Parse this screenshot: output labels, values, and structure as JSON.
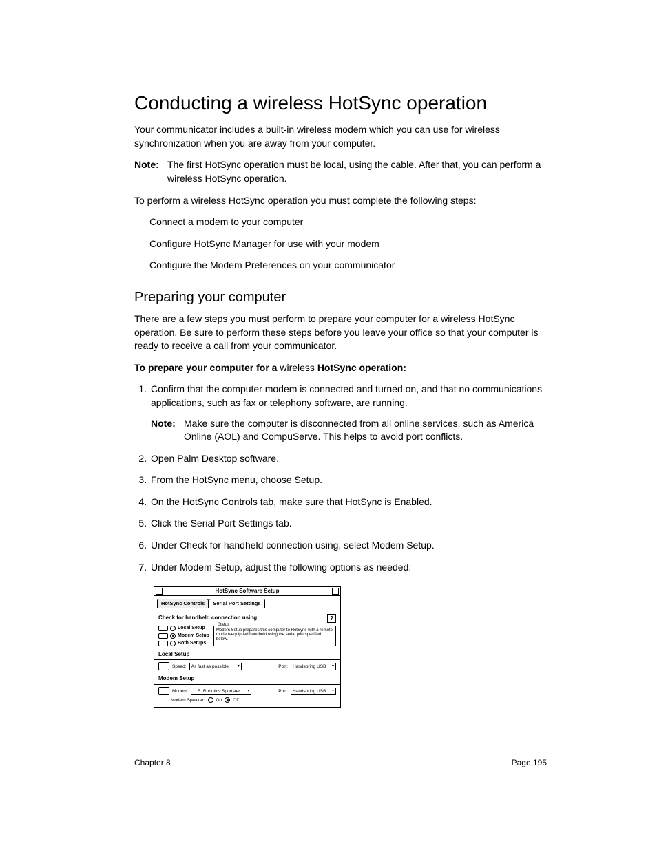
{
  "title": "Conducting a wireless HotSync operation",
  "intro": "Your communicator includes a built-in wireless modem which you can use for wireless synchronization when you are away from your computer.",
  "note1": {
    "label": "Note:",
    "text": "The first HotSync operation must be local, using the cable. After that, you can perform a wireless HotSync operation."
  },
  "lead": "To perform a wireless HotSync operation you must complete the following steps:",
  "bullets": [
    "Connect a modem to your computer",
    "Configure HotSync Manager for use with your modem",
    "Configure the Modem Preferences on your communicator"
  ],
  "subhead": "Preparing your computer",
  "subtext": "There are a few steps you must perform to prepare your computer for a wireless HotSync operation. Be sure to perform these steps before you leave your office so that your computer is ready to receive a call from your communicator.",
  "prep_bold_a": "To prepare your computer for a ",
  "prep_mid": "wireless ",
  "prep_bold_b": "HotSync operation:",
  "steps": [
    "Confirm that the computer modem is connected and turned on, and that no communications applications, such as fax or telephony software, are running.",
    "Open Palm Desktop software.",
    "From the HotSync menu, choose Setup.",
    "On the HotSync Controls tab, make sure that HotSync is Enabled.",
    "Click the Serial Port Settings tab.",
    "Under Check for handheld connection using, select Modem Setup.",
    "Under Modem Setup, adjust the following options as needed:"
  ],
  "inner_note": {
    "label": "Note:",
    "text": "Make sure the computer is disconnected from all online services, such as America Online (AOL) and CompuServe. This helps to avoid port conflicts."
  },
  "dialog": {
    "title": "HotSync Software Setup",
    "tabs": [
      "HotSync Controls",
      "Serial Port Settings"
    ],
    "check_label": "Check for handheld connection using:",
    "help": "?",
    "radios": [
      "Local Setup",
      "Modem Setup",
      "Both Setups"
    ],
    "status_legend": "Status",
    "status_text": "Modem Setup prepares this computer to HotSync with a remote modem-equipped handheld using the serial port specified below.",
    "local_title": "Local Setup",
    "speed_label": "Speed:",
    "speed_value": "As fast as possible",
    "port_label": "Port:",
    "port_value": "Handspring USB",
    "modem_title": "Modem Setup",
    "modem_label": "Modem:",
    "modem_value": "U.S. Robotics Sportster",
    "speaker_label": "Modem Speaker:",
    "speaker_on": "On",
    "speaker_off": "Off"
  },
  "footer": {
    "left": "Chapter 8",
    "right": "Page 195"
  }
}
